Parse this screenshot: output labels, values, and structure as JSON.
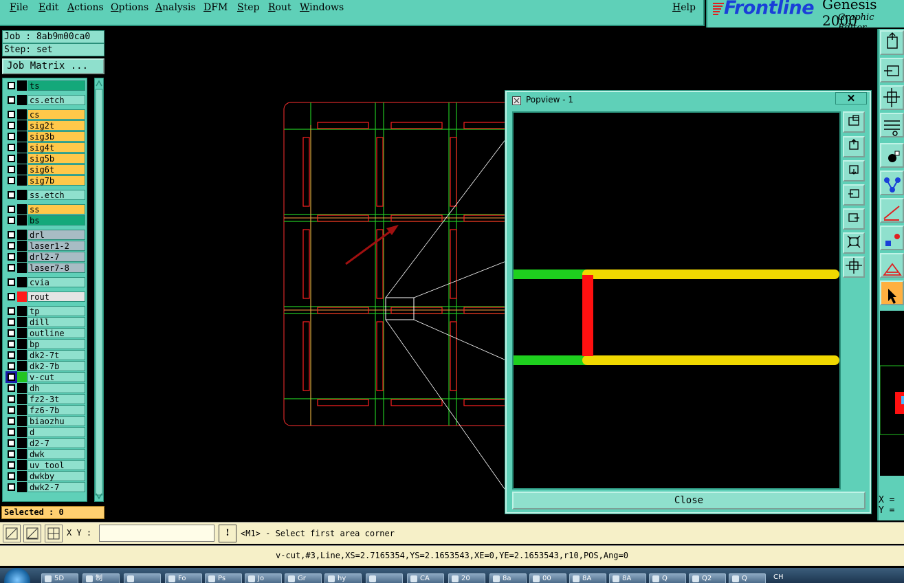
{
  "menubar": {
    "items": [
      "File",
      "Edit",
      "Actions",
      "Options",
      "Analysis",
      "DFM",
      "Step",
      "Rout",
      "Windows"
    ],
    "help": "Help"
  },
  "brand": {
    "logo": "Frontline",
    "product": "Genesis 2000",
    "subtitle": "Graphic Editor"
  },
  "left": {
    "job": "Job : 8ab9m00ca0",
    "step": "Step: set",
    "matrix_button": "Job Matrix ...",
    "selected": "Selected : 0"
  },
  "layers": [
    {
      "name": "ts",
      "color": "#14a87a",
      "swatch": "#000000",
      "checked": false
    },
    {
      "name": "cs.etch",
      "color": "#8fe0cd",
      "swatch": "#000000",
      "checked": false
    },
    {
      "name": "cs",
      "color": "#ffc84a",
      "swatch": "#000000",
      "checked": false
    },
    {
      "name": "sig2t",
      "color": "#ffc84a",
      "swatch": "#000000",
      "checked": false
    },
    {
      "name": "sig3b",
      "color": "#ffc84a",
      "swatch": "#000000",
      "checked": false
    },
    {
      "name": "sig4t",
      "color": "#ffc84a",
      "swatch": "#000000",
      "checked": false
    },
    {
      "name": "sig5b",
      "color": "#ffc84a",
      "swatch": "#000000",
      "checked": false
    },
    {
      "name": "sig6t",
      "color": "#ffc84a",
      "swatch": "#000000",
      "checked": false
    },
    {
      "name": "sig7b",
      "color": "#ffc84a",
      "swatch": "#000000",
      "checked": false
    },
    {
      "name": "ss.etch",
      "color": "#8fe0cd",
      "swatch": "#000000",
      "checked": false
    },
    {
      "name": "ss",
      "color": "#ffc84a",
      "swatch": "#000000",
      "checked": false
    },
    {
      "name": "bs",
      "color": "#14a87a",
      "swatch": "#000000",
      "checked": false
    },
    {
      "name": "drl",
      "color": "#a8bcc4",
      "swatch": "#000000",
      "checked": false
    },
    {
      "name": "laser1-2",
      "color": "#a8bcc4",
      "swatch": "#000000",
      "checked": false
    },
    {
      "name": "drl2-7",
      "color": "#a8bcc4",
      "swatch": "#000000",
      "checked": false
    },
    {
      "name": "laser7-8",
      "color": "#a8bcc4",
      "swatch": "#000000",
      "checked": false
    },
    {
      "name": "cvia",
      "color": "#8fe0cd",
      "swatch": "#000000",
      "checked": false
    },
    {
      "name": "rout",
      "color": "#e4e4e4",
      "swatch": "#ff1a1a",
      "checked": false
    },
    {
      "name": "tp",
      "color": "#8fe0cd",
      "swatch": "#000000",
      "checked": false
    },
    {
      "name": "dill",
      "color": "#8fe0cd",
      "swatch": "#000000",
      "checked": false
    },
    {
      "name": "outline",
      "color": "#8fe0cd",
      "swatch": "#000000",
      "checked": false
    },
    {
      "name": "bp",
      "color": "#8fe0cd",
      "swatch": "#000000",
      "checked": false
    },
    {
      "name": "dk2-7t",
      "color": "#8fe0cd",
      "swatch": "#000000",
      "checked": false
    },
    {
      "name": "dk2-7b",
      "color": "#8fe0cd",
      "swatch": "#000000",
      "checked": false
    },
    {
      "name": "v-cut",
      "color": "#8fe0cd",
      "swatch": "#22c422",
      "checked": true
    },
    {
      "name": "dh",
      "color": "#8fe0cd",
      "swatch": "#000000",
      "checked": false
    },
    {
      "name": "fz2-3t",
      "color": "#8fe0cd",
      "swatch": "#000000",
      "checked": false
    },
    {
      "name": "fz6-7b",
      "color": "#8fe0cd",
      "swatch": "#000000",
      "checked": false
    },
    {
      "name": "biaozhu",
      "color": "#8fe0cd",
      "swatch": "#000000",
      "checked": false
    },
    {
      "name": "d",
      "color": "#8fe0cd",
      "swatch": "#000000",
      "checked": false
    },
    {
      "name": "d2-7",
      "color": "#8fe0cd",
      "swatch": "#000000",
      "checked": false
    },
    {
      "name": "dwk",
      "color": "#8fe0cd",
      "swatch": "#000000",
      "checked": false
    },
    {
      "name": "uv_tool",
      "color": "#8fe0cd",
      "swatch": "#000000",
      "checked": false
    },
    {
      "name": "dwkby",
      "color": "#8fe0cd",
      "swatch": "#000000",
      "checked": false
    },
    {
      "name": "dwk2-7",
      "color": "#8fe0cd",
      "swatch": "#000000",
      "checked": false
    }
  ],
  "popview": {
    "title": "Popview - 1",
    "close_x": "✕",
    "close_button": "Close"
  },
  "readout": {
    "x_label": "X =",
    "y_label": "Y ="
  },
  "command": {
    "xy_label": "X Y :",
    "xy_value": "",
    "excl": "!",
    "prompt": "<M1> - Select first area corner"
  },
  "status": {
    "text": "v-cut,#3,Line,XS=2.7165354,YS=2.1653543,XE=0,YE=2.1653543,r10,POS,Ang=0"
  },
  "taskbar": {
    "buttons": [
      "5D",
      "制",
      "",
      "Fo",
      "Ps",
      "Jo",
      "Gr",
      "hy",
      "",
      "CA",
      "20",
      "8a",
      "00",
      "8A",
      "8A",
      "Q",
      "Q2",
      "Q"
    ],
    "tray": "CH"
  },
  "colors": {
    "panel": "#5fd0b8",
    "panel_light": "#8fe0cd",
    "vcut": "#22c422",
    "rout": "#ff1a1a",
    "signal": "#ffc84a",
    "yellow_track": "#f0d000"
  }
}
